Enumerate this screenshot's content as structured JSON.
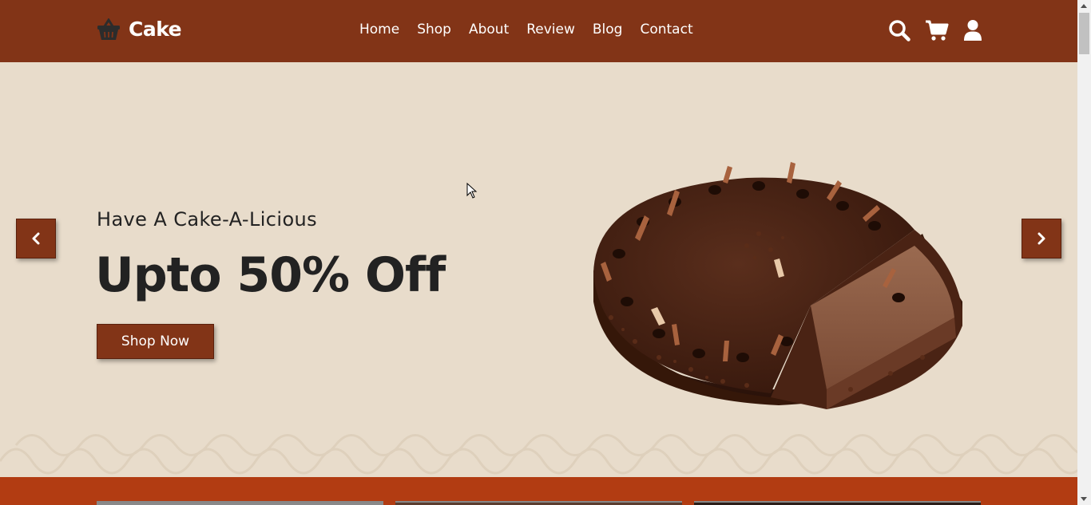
{
  "header": {
    "logo_text": "Cake",
    "logo_icon": "basket-icon",
    "nav": [
      {
        "label": "Home"
      },
      {
        "label": "Shop"
      },
      {
        "label": "About"
      },
      {
        "label": "Review"
      },
      {
        "label": "Blog"
      },
      {
        "label": "Contact"
      }
    ],
    "icons": [
      "search-icon",
      "cart-icon",
      "user-icon"
    ]
  },
  "hero": {
    "subtitle": "Have A Cake-A-Licious",
    "title": "Upto 50% Off",
    "button_label": "Shop Now",
    "prev_icon": "chevron-left-icon",
    "next_icon": "chevron-right-icon"
  },
  "colors": {
    "brand": "#823417",
    "hero_bg": "#e8dccb",
    "band": "#b23c12",
    "text": "#222222"
  }
}
